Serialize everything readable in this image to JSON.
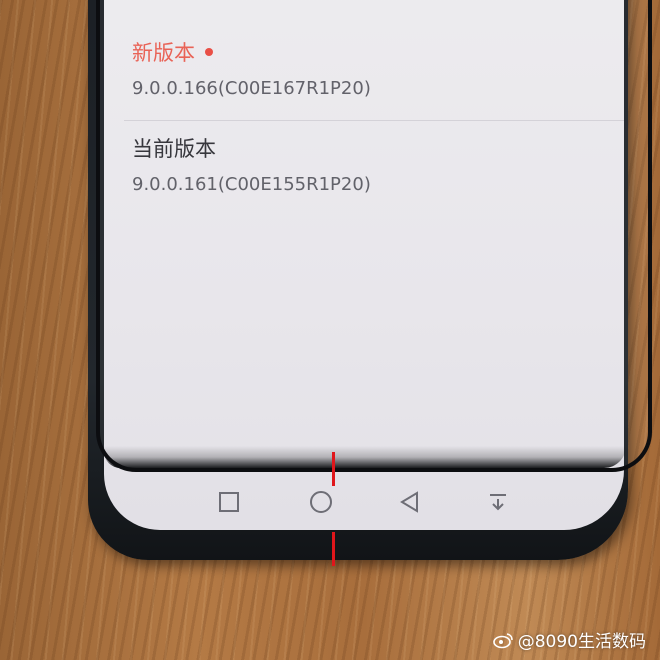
{
  "update_screen": {
    "new_version_label": "新版本",
    "new_version_value": "9.0.0.166(C00E167R1P20)",
    "current_version_label": "当前版本",
    "current_version_value": "9.0.0.161(C00E155R1P20)"
  },
  "nav_bar": {
    "buttons": [
      "recent-apps-square",
      "home-circle",
      "back-triangle",
      "notification-down-arrow"
    ]
  },
  "watermark": {
    "text": "@8090生活数码",
    "icon": "weibo-icon"
  },
  "colors": {
    "new_label": "#e85b4e",
    "indicator_dot": "#e8463d",
    "alignment_marks": "#e0161b"
  }
}
